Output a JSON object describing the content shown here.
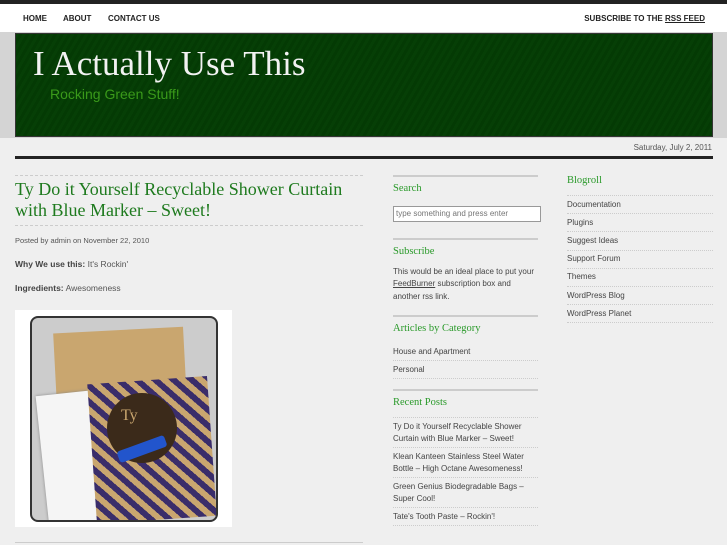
{
  "nav": {
    "items": [
      "HOME",
      "ABOUT",
      "CONTACT US"
    ],
    "subscribe_prefix": "SUBSCRIBE TO THE",
    "subscribe_link": "RSS FEED"
  },
  "header": {
    "title": "I Actually Use This",
    "tagline": "Rocking Green Stuff!"
  },
  "date": "Saturday, July 2, 2011",
  "post": {
    "title": "Ty Do it Yourself Recyclable Shower Curtain with Blue Marker – Sweet!",
    "meta": "Posted by admin on November 22, 2010",
    "why_label": "Why We use this:",
    "why_value": "It's Rockin'",
    "ingredients_label": "Ingredients:",
    "ingredients_value": "Awesomeness",
    "image_text": "Ty"
  },
  "sidebar": {
    "search": {
      "title": "Search",
      "placeholder": "type something and press enter"
    },
    "subscribe": {
      "title": "Subscribe",
      "text_before": "This would be an ideal place to put your ",
      "link": "FeedBurner",
      "text_after": " subscription box and another rss link."
    },
    "categories": {
      "title": "Articles by Category",
      "items": [
        "House and Apartment",
        "Personal"
      ]
    },
    "recent": {
      "title": "Recent Posts",
      "items": [
        "Ty Do it Yourself Recyclable Shower Curtain with Blue Marker – Sweet!",
        "Klean Kanteen Stainless Steel Water Bottle – High Octane Awesomeness!",
        "Green Genius Biodegradable Bags – Super Cool!",
        "Tate's Tooth Paste – Rockin'!"
      ]
    },
    "blogroll": {
      "title": "Blogroll",
      "items": [
        "Documentation",
        "Plugins",
        "Suggest Ideas",
        "Support Forum",
        "Themes",
        "WordPress Blog",
        "WordPress Planet"
      ]
    }
  },
  "colors": {
    "header_bg": "#043a04",
    "accent": "#2a9a2a",
    "title_green": "#1e7a1e"
  }
}
